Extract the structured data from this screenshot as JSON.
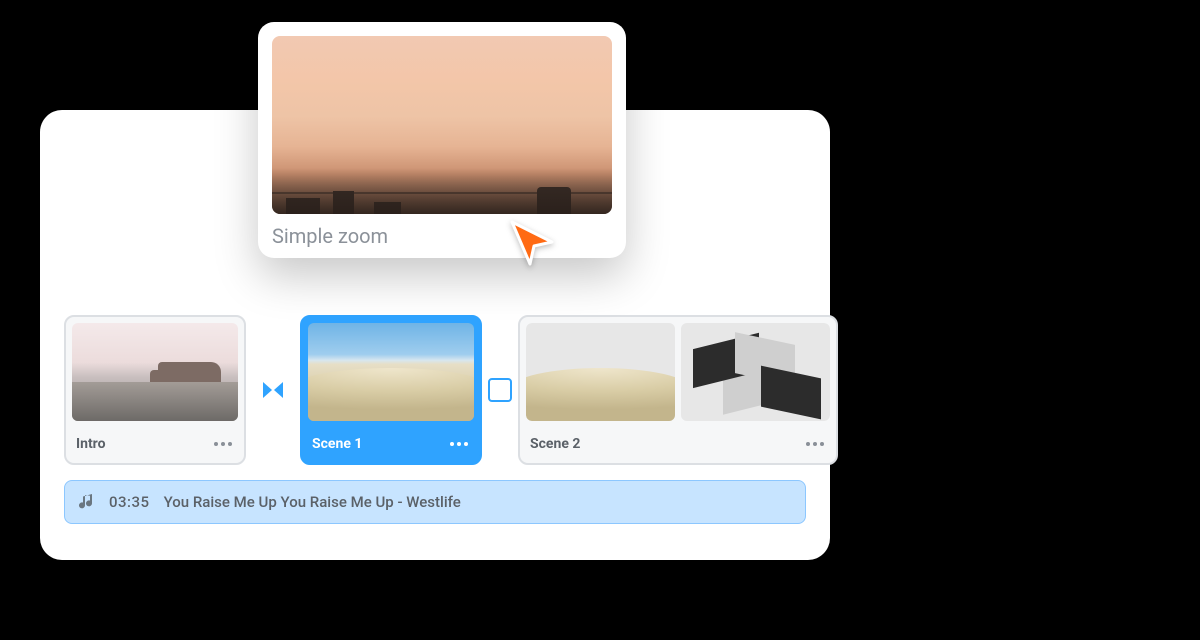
{
  "preview": {
    "label": "Simple zoom"
  },
  "timeline": {
    "scenes": [
      {
        "label": "Intro",
        "selected": false
      },
      {
        "label": "Scene 1",
        "selected": true
      },
      {
        "label": "Scene 2",
        "selected": false
      }
    ]
  },
  "audio": {
    "time": "03:35",
    "title": "You Raise Me Up You Raise Me Up - Westlife"
  },
  "icons": {
    "transition": "transition-icon",
    "music_note": "music-note-icon",
    "cursor": "cursor-icon",
    "more": "more-icon"
  },
  "colors": {
    "accent": "#2fa3ff",
    "audio_bg": "#c7e4ff",
    "cursor": "#ff6a13"
  }
}
